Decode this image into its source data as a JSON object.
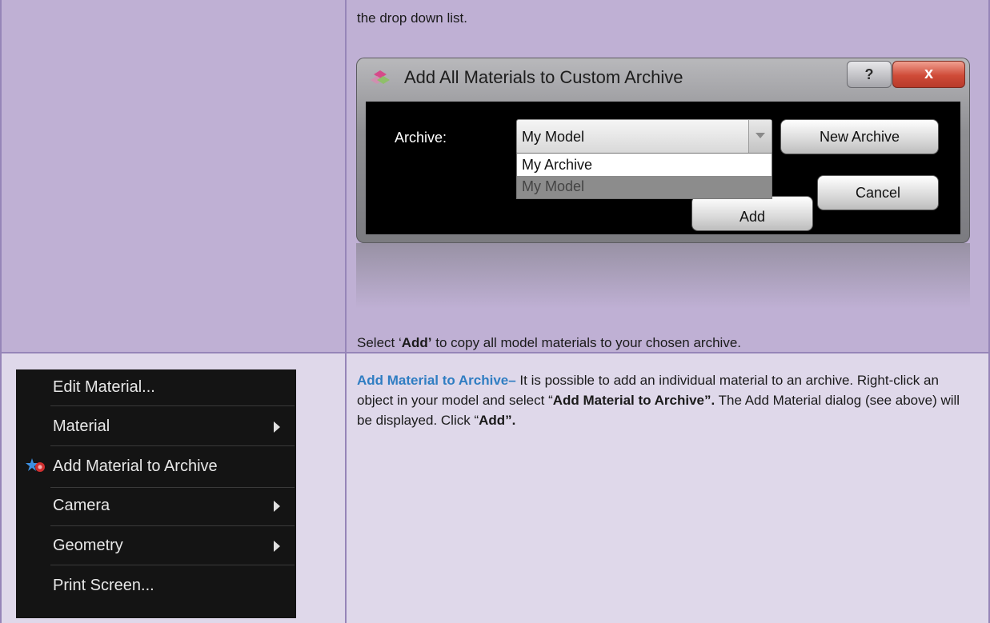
{
  "top_text": "the drop down list.",
  "dialog": {
    "title": "Add All Materials to Custom Archive",
    "help_label": "?",
    "close_label": "x",
    "archive_label": "Archive:",
    "combo_value": "My Model",
    "options": [
      "My Archive",
      "My Model"
    ],
    "new_archive_label": "New Archive",
    "add_label": "Add",
    "cancel_label": "Cancel"
  },
  "select_add_text": {
    "pre": "Select ‘",
    "bold": "Add’",
    "post": " to copy all model materials to your chosen archive."
  },
  "context_menu": {
    "items": [
      {
        "label": "Edit Material..."
      },
      {
        "label": "Material"
      },
      {
        "label": "Add Material to Archive"
      },
      {
        "label": "Camera"
      },
      {
        "label": "Geometry"
      },
      {
        "label": "Print Screen..."
      }
    ]
  },
  "description": {
    "heading": "Add Material to Archive–",
    "t1": " It is possible to add an individual material to an archive. Right-click an object in your model and select “",
    "b1": "Add Material to Archive”.",
    "t2": " The Add Material dialog (see above) will be displayed. Click “",
    "b2": "Add”."
  },
  "colors": {
    "row_top": "#bfb0d4",
    "row_bottom": "#dfd8ea",
    "border": "#9685b8",
    "heading_blue": "#2f7dc2"
  }
}
